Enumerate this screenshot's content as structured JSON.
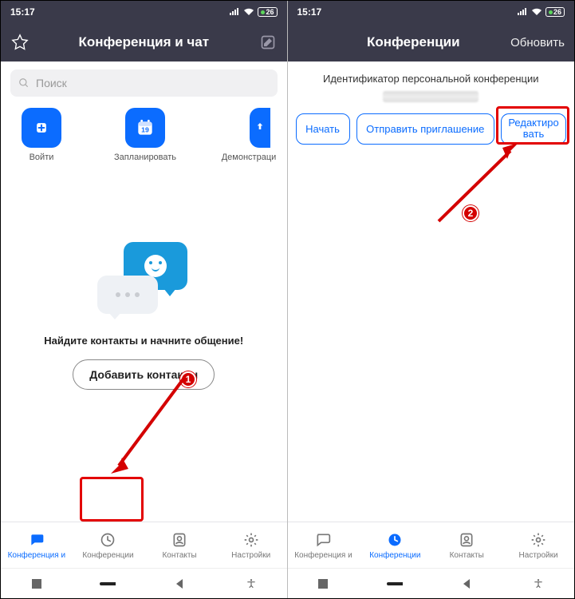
{
  "status": {
    "time": "15:17",
    "battery": "26"
  },
  "screen1": {
    "title": "Конференция и чат",
    "search_placeholder": "Поиск",
    "actions": {
      "join": "Войти",
      "schedule": "Запланировать",
      "schedule_day": "19",
      "share": "Демонстраци"
    },
    "prompt": "Найдите контакты и начните общение!",
    "add_contacts": "Добавить контакты",
    "nav": {
      "chat": "Конференция и",
      "meetings": "Конференции",
      "contacts": "Контакты",
      "settings": "Настройки"
    }
  },
  "screen2": {
    "title": "Конференции",
    "refresh": "Обновить",
    "pci_label": "Идентификатор персональной конференции",
    "buttons": {
      "start": "Начать",
      "send": "Отправить приглашение",
      "edit1": "Редактиро",
      "edit2": "вать"
    },
    "nav": {
      "chat": "Конференция и",
      "meetings": "Конференции",
      "contacts": "Контакты",
      "settings": "Настройки"
    }
  },
  "annotations": {
    "step1": "1",
    "step2": "2"
  }
}
